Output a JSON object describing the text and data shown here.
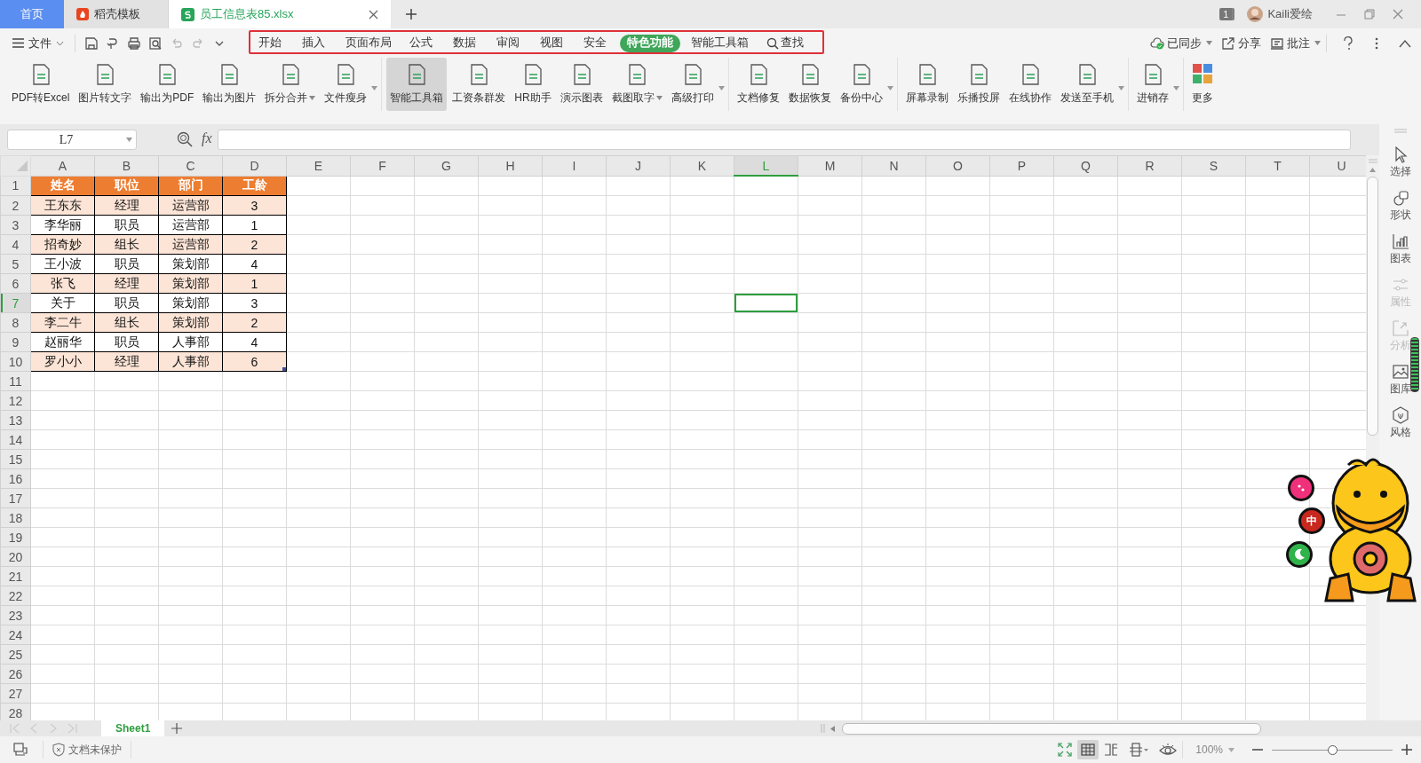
{
  "tabs": [
    {
      "label": "首页",
      "kind": "home",
      "selected": false
    },
    {
      "label": "稻壳模板",
      "kind": "docer",
      "selected": false
    },
    {
      "label": "员工信息表85.xlsx",
      "kind": "sheet",
      "selected": true
    }
  ],
  "title_bar": {
    "window_count": "1",
    "user": "Kaili爱绘"
  },
  "menu": {
    "file": "文件",
    "tabs": [
      {
        "label": "开始",
        "selected": false
      },
      {
        "label": "插入",
        "selected": false
      },
      {
        "label": "页面布局",
        "selected": false
      },
      {
        "label": "公式",
        "selected": false
      },
      {
        "label": "数据",
        "selected": false
      },
      {
        "label": "审阅",
        "selected": false
      },
      {
        "label": "视图",
        "selected": false
      },
      {
        "label": "安全",
        "selected": false
      },
      {
        "label": "特色功能",
        "selected": true
      },
      {
        "label": "智能工具箱",
        "selected": false
      }
    ],
    "search": "查找",
    "actions": [
      {
        "label": "已同步",
        "kind": "sync",
        "dropdown": true
      },
      {
        "label": "分享",
        "kind": "share",
        "dropdown": false
      },
      {
        "label": "批注",
        "kind": "comment",
        "dropdown": true
      }
    ]
  },
  "ribbon": {
    "groups": [
      {
        "expander": true,
        "items": [
          {
            "label": "PDF转Excel",
            "kind": "page",
            "dropdown": false,
            "selected": false
          },
          {
            "label": "图片转文字",
            "kind": "page",
            "dropdown": false,
            "selected": false
          },
          {
            "label": "输出为PDF",
            "kind": "page",
            "dropdown": false,
            "selected": false
          },
          {
            "label": "输出为图片",
            "kind": "page",
            "dropdown": false,
            "selected": false
          },
          {
            "label": "拆分合并",
            "kind": "page",
            "dropdown": true,
            "selected": false
          },
          {
            "label": "文件瘦身",
            "kind": "page",
            "dropdown": false,
            "selected": false
          }
        ]
      },
      {
        "expander": true,
        "items": [
          {
            "label": "智能工具箱",
            "kind": "page",
            "dropdown": false,
            "selected": true
          },
          {
            "label": "工资条群发",
            "kind": "page",
            "dropdown": false,
            "selected": false
          },
          {
            "label": "HR助手",
            "kind": "page",
            "dropdown": false,
            "selected": false
          },
          {
            "label": "演示图表",
            "kind": "page",
            "dropdown": false,
            "selected": false
          },
          {
            "label": "截图取字",
            "kind": "page",
            "dropdown": true,
            "selected": false
          },
          {
            "label": "高级打印",
            "kind": "page",
            "dropdown": false,
            "selected": false
          }
        ]
      },
      {
        "expander": true,
        "items": [
          {
            "label": "文档修复",
            "kind": "page",
            "dropdown": false,
            "selected": false
          },
          {
            "label": "数据恢复",
            "kind": "page",
            "dropdown": false,
            "selected": false
          },
          {
            "label": "备份中心",
            "kind": "page",
            "dropdown": false,
            "selected": false
          }
        ]
      },
      {
        "expander": true,
        "items": [
          {
            "label": "屏幕录制",
            "kind": "page",
            "dropdown": false,
            "selected": false
          },
          {
            "label": "乐播投屏",
            "kind": "page",
            "dropdown": false,
            "selected": false
          },
          {
            "label": "在线协作",
            "kind": "page",
            "dropdown": false,
            "selected": false
          },
          {
            "label": "发送至手机",
            "kind": "page",
            "dropdown": false,
            "selected": false
          }
        ]
      },
      {
        "expander": true,
        "items": [
          {
            "label": "进销存",
            "kind": "page",
            "dropdown": false,
            "selected": false
          }
        ]
      },
      {
        "items": [
          {
            "label": "更多",
            "kind": "tiles",
            "dropdown": false,
            "selected": false
          }
        ]
      }
    ]
  },
  "formula_bar": {
    "name_box": "L7",
    "fx": "fx"
  },
  "sheet": {
    "columns": [
      {
        "label": "A",
        "selected": false
      },
      {
        "label": "B",
        "selected": false
      },
      {
        "label": "C",
        "selected": false
      },
      {
        "label": "D",
        "selected": false
      },
      {
        "label": "E",
        "selected": false
      },
      {
        "label": "F",
        "selected": false
      },
      {
        "label": "G",
        "selected": false
      },
      {
        "label": "H",
        "selected": false
      },
      {
        "label": "I",
        "selected": false
      },
      {
        "label": "J",
        "selected": false
      },
      {
        "label": "K",
        "selected": false
      },
      {
        "label": "L",
        "selected": true
      },
      {
        "label": "M",
        "selected": false
      },
      {
        "label": "N",
        "selected": false
      },
      {
        "label": "O",
        "selected": false
      },
      {
        "label": "P",
        "selected": false
      },
      {
        "label": "Q",
        "selected": false
      },
      {
        "label": "R",
        "selected": false
      },
      {
        "label": "S",
        "selected": false
      },
      {
        "label": "T",
        "selected": false
      },
      {
        "label": "U",
        "selected": false
      }
    ],
    "rows": [
      {
        "number": "1",
        "selected": false,
        "kind": "header",
        "cells": [
          "姓名",
          "职位",
          "部门",
          "工龄"
        ]
      },
      {
        "number": "2",
        "selected": false,
        "kind": "shaded",
        "cells": [
          "王东东",
          "经理",
          "运营部",
          "3"
        ]
      },
      {
        "number": "3",
        "selected": false,
        "kind": "plain",
        "cells": [
          "李华丽",
          "职员",
          "运营部",
          "1"
        ]
      },
      {
        "number": "4",
        "selected": false,
        "kind": "shaded",
        "cells": [
          "招奇妙",
          "组长",
          "运营部",
          "2"
        ]
      },
      {
        "number": "5",
        "selected": false,
        "kind": "plain",
        "cells": [
          "王小波",
          "职员",
          "策划部",
          "4"
        ]
      },
      {
        "number": "6",
        "selected": false,
        "kind": "shaded",
        "cells": [
          "张飞",
          "经理",
          "策划部",
          "1"
        ]
      },
      {
        "number": "7",
        "selected": true,
        "kind": "plain",
        "cells": [
          "关于",
          "职员",
          "策划部",
          "3"
        ]
      },
      {
        "number": "8",
        "selected": false,
        "kind": "shaded",
        "cells": [
          "李二牛",
          "组长",
          "策划部",
          "2"
        ]
      },
      {
        "number": "9",
        "selected": false,
        "kind": "plain",
        "cells": [
          "赵丽华",
          "职员",
          "人事部",
          "4"
        ]
      },
      {
        "number": "10",
        "selected": false,
        "kind": "shaded",
        "cells": [
          "罗小小",
          "经理",
          "人事部",
          "6"
        ]
      },
      {
        "number": "11",
        "selected": false
      },
      {
        "number": "12",
        "selected": false
      },
      {
        "number": "13",
        "selected": false
      },
      {
        "number": "14",
        "selected": false
      },
      {
        "number": "15",
        "selected": false
      },
      {
        "number": "16",
        "selected": false
      },
      {
        "number": "17",
        "selected": false
      },
      {
        "number": "18",
        "selected": false
      },
      {
        "number": "19",
        "selected": false
      },
      {
        "number": "20",
        "selected": false
      },
      {
        "number": "21",
        "selected": false
      },
      {
        "number": "22",
        "selected": false
      },
      {
        "number": "23",
        "selected": false
      },
      {
        "number": "24",
        "selected": false
      },
      {
        "number": "25",
        "selected": false
      },
      {
        "number": "26",
        "selected": false
      },
      {
        "number": "27",
        "selected": false
      },
      {
        "number": "28",
        "selected": false
      }
    ]
  },
  "side_panel": [
    {
      "label": "选择",
      "kind": "pointer",
      "disabled": false
    },
    {
      "label": "形状",
      "kind": "shapes",
      "disabled": false
    },
    {
      "label": "图表",
      "kind": "chart",
      "disabled": false
    },
    {
      "label": "属性",
      "kind": "sliders",
      "disabled": true
    },
    {
      "label": "分析",
      "kind": "frame",
      "disabled": true
    },
    {
      "label": "图库",
      "kind": "picture",
      "disabled": false
    },
    {
      "label": "风格",
      "kind": "hexagon",
      "disabled": false
    }
  ],
  "sheet_tabs": [
    {
      "label": "Sheet1",
      "selected": true
    }
  ],
  "status_bar": {
    "protection": "文档未保护",
    "zoom": "100%",
    "zoom_slider": {
      "level": 0.5
    }
  },
  "float_widget": {
    "ime": "中"
  }
}
